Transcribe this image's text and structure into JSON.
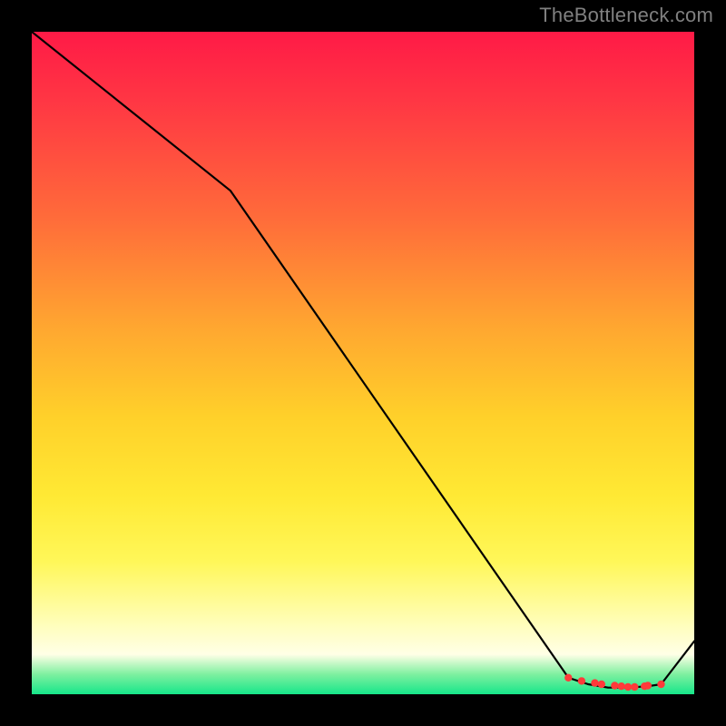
{
  "watermark": "TheBottleneck.com",
  "chart_data": {
    "type": "line",
    "title": "",
    "xlabel": "",
    "ylabel": "",
    "xlim": [
      0,
      100
    ],
    "ylim": [
      0,
      100
    ],
    "grid": false,
    "series": [
      {
        "name": "curve",
        "x": [
          0,
          30,
          81,
          84,
          87,
          90,
          93,
          95,
          100
        ],
        "values": [
          100,
          76,
          2.5,
          1.5,
          1.0,
          1.0,
          1.2,
          1.5,
          8
        ]
      }
    ],
    "markers": {
      "x": [
        81,
        83,
        85,
        86,
        88,
        89,
        90,
        91,
        92.5,
        93,
        95
      ],
      "values": [
        2.5,
        2.0,
        1.7,
        1.5,
        1.3,
        1.2,
        1.1,
        1.1,
        1.2,
        1.3,
        1.5
      ],
      "color": "#ff3a3a"
    },
    "gradient_stops": [
      {
        "pos": 0,
        "color": "#ff1a46"
      },
      {
        "pos": 28,
        "color": "#ff6b3a"
      },
      {
        "pos": 58,
        "color": "#ffd02a"
      },
      {
        "pos": 80,
        "color": "#fff759"
      },
      {
        "pos": 94,
        "color": "#ffffe6"
      },
      {
        "pos": 100,
        "color": "#16e68a"
      }
    ]
  }
}
